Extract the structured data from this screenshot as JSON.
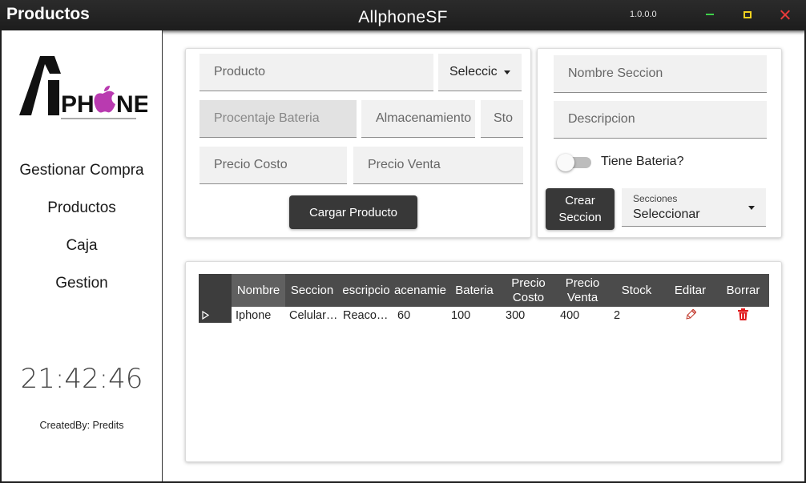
{
  "window": {
    "title": "Productos",
    "app_name": "AllphoneSF",
    "version": "1.0.0.0"
  },
  "sidebar": {
    "logo_text": "APHONE",
    "nav": [
      "Gestionar Compra",
      "Productos",
      "Caja",
      "Gestion"
    ],
    "clock": "21:42:46",
    "created_by": "CreatedBy: Predits"
  },
  "product_form": {
    "producto_placeholder": "Producto",
    "seccion_select": "Seleccic",
    "bateria_placeholder": "Procentaje Bateria",
    "almacenamiento_placeholder": "Almacenamiento",
    "stock_placeholder": "Sto",
    "precio_costo_placeholder": "Precio Costo",
    "precio_venta_placeholder": "Precio Venta",
    "submit_label": "Cargar Producto"
  },
  "section_form": {
    "nombre_placeholder": "Nombre Seccion",
    "descripcion_placeholder": "Descripcion",
    "toggle_label": "Tiene Bateria?",
    "toggle_on": false,
    "create_label_line1": "Crear",
    "create_label_line2": "Seccion",
    "secciones_label": "Secciones",
    "secciones_value": "Seleccionar"
  },
  "table": {
    "columns": [
      "Nombre",
      "Seccion",
      "escripcio",
      "acenamie",
      "Bateria",
      "Precio Costo",
      "Precio Venta",
      "Stock",
      "Editar",
      "Borrar"
    ],
    "rows": [
      [
        "Iphone",
        "Celular…",
        "Reaco…",
        "60",
        "100",
        "300",
        "400",
        "2"
      ]
    ]
  },
  "colors": {
    "titlebar": "#1d1d1d",
    "header": "#4b4b4b",
    "button": "#383838",
    "accent_pink": "#b93ab0",
    "delete_red": "#e0191b",
    "close_red": "#e83a3a",
    "min_green": "#3fd04a",
    "max_yellow": "#f4d21f"
  }
}
